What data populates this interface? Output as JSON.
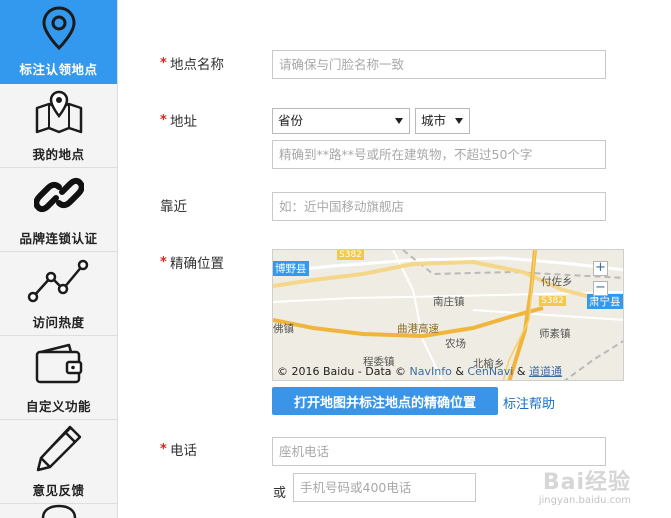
{
  "sidebar": {
    "items": [
      {
        "label": "标注认领地点",
        "icon": "location-pin-icon",
        "active": true
      },
      {
        "label": "我的地点",
        "icon": "map-fold-icon"
      },
      {
        "label": "品牌连锁认证",
        "icon": "chain-link-icon"
      },
      {
        "label": "访问热度",
        "icon": "line-trend-icon"
      },
      {
        "label": "自定义功能",
        "icon": "wallet-icon"
      },
      {
        "label": "意见反馈",
        "icon": "pencil-icon"
      }
    ]
  },
  "form": {
    "required_mark": "*",
    "name": {
      "label": "地点名称",
      "placeholder": "请确保与门脸名称一致"
    },
    "address": {
      "label": "地址",
      "province": "省份",
      "city": "城市",
      "placeholder": "精确到**路**号或所在建筑物，不超过50个字"
    },
    "nearby": {
      "label": "靠近",
      "placeholder": "如：近中国移动旗舰店"
    },
    "position": {
      "label": "精确位置",
      "map_labels": {
        "county_left": "博野县",
        "county_right": "肃宁县",
        "road_s382_a": "S382",
        "road_s382_b": "S382",
        "town_fuzuo": "付佐乡",
        "town_nanzhuang": "南庄镇",
        "highway": "曲港高速",
        "town_shisu": "师素镇",
        "farm": "农场",
        "town_beiyu": "北榆乡",
        "town_chengxiu": "程委镇",
        "town_fu": "佛镇"
      },
      "zoom_in": "+",
      "zoom_out": "−",
      "copyright_prefix": "© 2016 Baidu - Data ©",
      "copyright_navinfo": "NavInfo",
      "copyright_amp1": "&",
      "copyright_cennavi": "CenNavi",
      "copyright_amp2": "&",
      "copyright_daodao": "道道通",
      "open_map_button": "打开地图并标注地点的精确位置",
      "help_link": "标注帮助"
    },
    "phone": {
      "label": "电话",
      "landline_placeholder": "座机电话",
      "or_label": "或",
      "mobile_placeholder": "手机号码或400电话"
    }
  },
  "watermark": {
    "brand": "Bai经验",
    "url": "jingyan.baidu.com"
  },
  "colors": {
    "accent": "#3399ee",
    "required": "#e62117",
    "link": "#1a6fc4"
  }
}
